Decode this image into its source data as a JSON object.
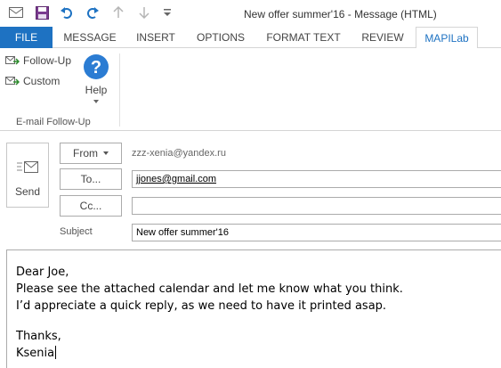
{
  "window": {
    "title": "New offer summer'16 - Message (HTML)"
  },
  "quick_access": {
    "icons": [
      "envelope-icon",
      "save-icon",
      "undo-icon",
      "redo-icon",
      "up-arrow-icon",
      "down-arrow-icon",
      "customize-icon"
    ]
  },
  "tabs": [
    {
      "label": "FILE"
    },
    {
      "label": "MESSAGE"
    },
    {
      "label": "INSERT"
    },
    {
      "label": "OPTIONS"
    },
    {
      "label": "FORMAT TEXT"
    },
    {
      "label": "REVIEW"
    },
    {
      "label": "MAPILab"
    }
  ],
  "active_tab": "MAPILab",
  "ribbon": {
    "follow_up_label": "Follow-Up",
    "custom_label": "Custom",
    "help_label": "Help",
    "group_label": "E-mail Follow-Up"
  },
  "compose": {
    "send_label": "Send",
    "from_label": "From",
    "from_address": "zzz-xenia@yandex.ru",
    "to_label": "To...",
    "to_value": "jjones@gmail.com",
    "cc_label": "Cc...",
    "cc_value": "",
    "subject_label": "Subject",
    "subject_value": "New offer summer'16"
  },
  "message_body": {
    "lines": [
      "Dear Joe,",
      "Please see the attached calendar and let me know what you think.",
      "I’d appreciate a quick reply, as we need to have it printed asap.",
      "",
      "Thanks,",
      "Ksenia"
    ]
  },
  "colors": {
    "accent": "#1e72c2",
    "help_icon": "#2b7cd3"
  }
}
